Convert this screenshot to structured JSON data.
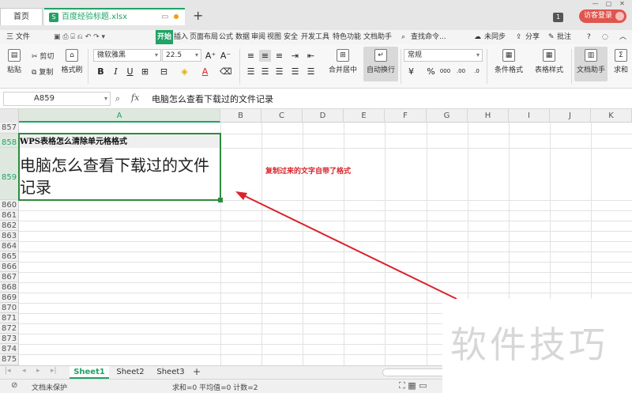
{
  "titlebar": {
    "home_tab": "首页",
    "doc_name": "百度经验标题.xlsx",
    "new_tab": "+",
    "tab_count": "1",
    "login": "访客登录",
    "win_controls": [
      "—",
      "▢",
      "✕"
    ]
  },
  "menu": {
    "file": "三 文件",
    "items": [
      "开始",
      "插入",
      "页面布局",
      "公式",
      "数据",
      "审阅",
      "视图",
      "安全",
      "开发工具",
      "特色功能",
      "文档助手"
    ],
    "search": "查找命令...",
    "sync": "未同步",
    "share": "分享",
    "comment": "批注",
    "help": "?"
  },
  "ribbon": {
    "paste": "粘贴",
    "cut": "剪切",
    "copy": "复制",
    "format_painter": "格式刷",
    "font_name": "微软雅黑",
    "font_size": "22.5",
    "merge_center": "合并居中",
    "wrap_text": "自动换行",
    "number_format": "常规",
    "cond_format": "条件格式",
    "table_style": "表格样式",
    "doc_assistant": "文档助手",
    "sum": "求和"
  },
  "formula_bar": {
    "cell_ref": "A859",
    "fx": "fx",
    "content": "电脑怎么查看下载过的文件记录"
  },
  "grid": {
    "columns": [
      "A",
      "B",
      "C",
      "D",
      "E",
      "F",
      "G",
      "H",
      "I",
      "J",
      "K"
    ],
    "rows": [
      "857",
      "858",
      "859",
      "860",
      "861",
      "862",
      "863",
      "864",
      "865",
      "866",
      "867",
      "868",
      "869",
      "870",
      "871",
      "872",
      "873",
      "874",
      "875"
    ],
    "cell_858": "WPS表格怎么清除单元格格式",
    "cell_859": "电脑怎么查看下载过的文件记录",
    "annotation": "复制过来的文字自带了格式"
  },
  "sheets": {
    "tabs": [
      "Sheet1",
      "Sheet2",
      "Sheet3"
    ],
    "active": "Sheet1",
    "add": "+"
  },
  "status": {
    "protect": "文档未保护",
    "stats": "求和=0   平均值=0   计数=2"
  },
  "watermark": "软件技巧",
  "colors": {
    "accent": "#21a366",
    "annotation": "#d9242b",
    "selection": "#2e8b3e"
  }
}
